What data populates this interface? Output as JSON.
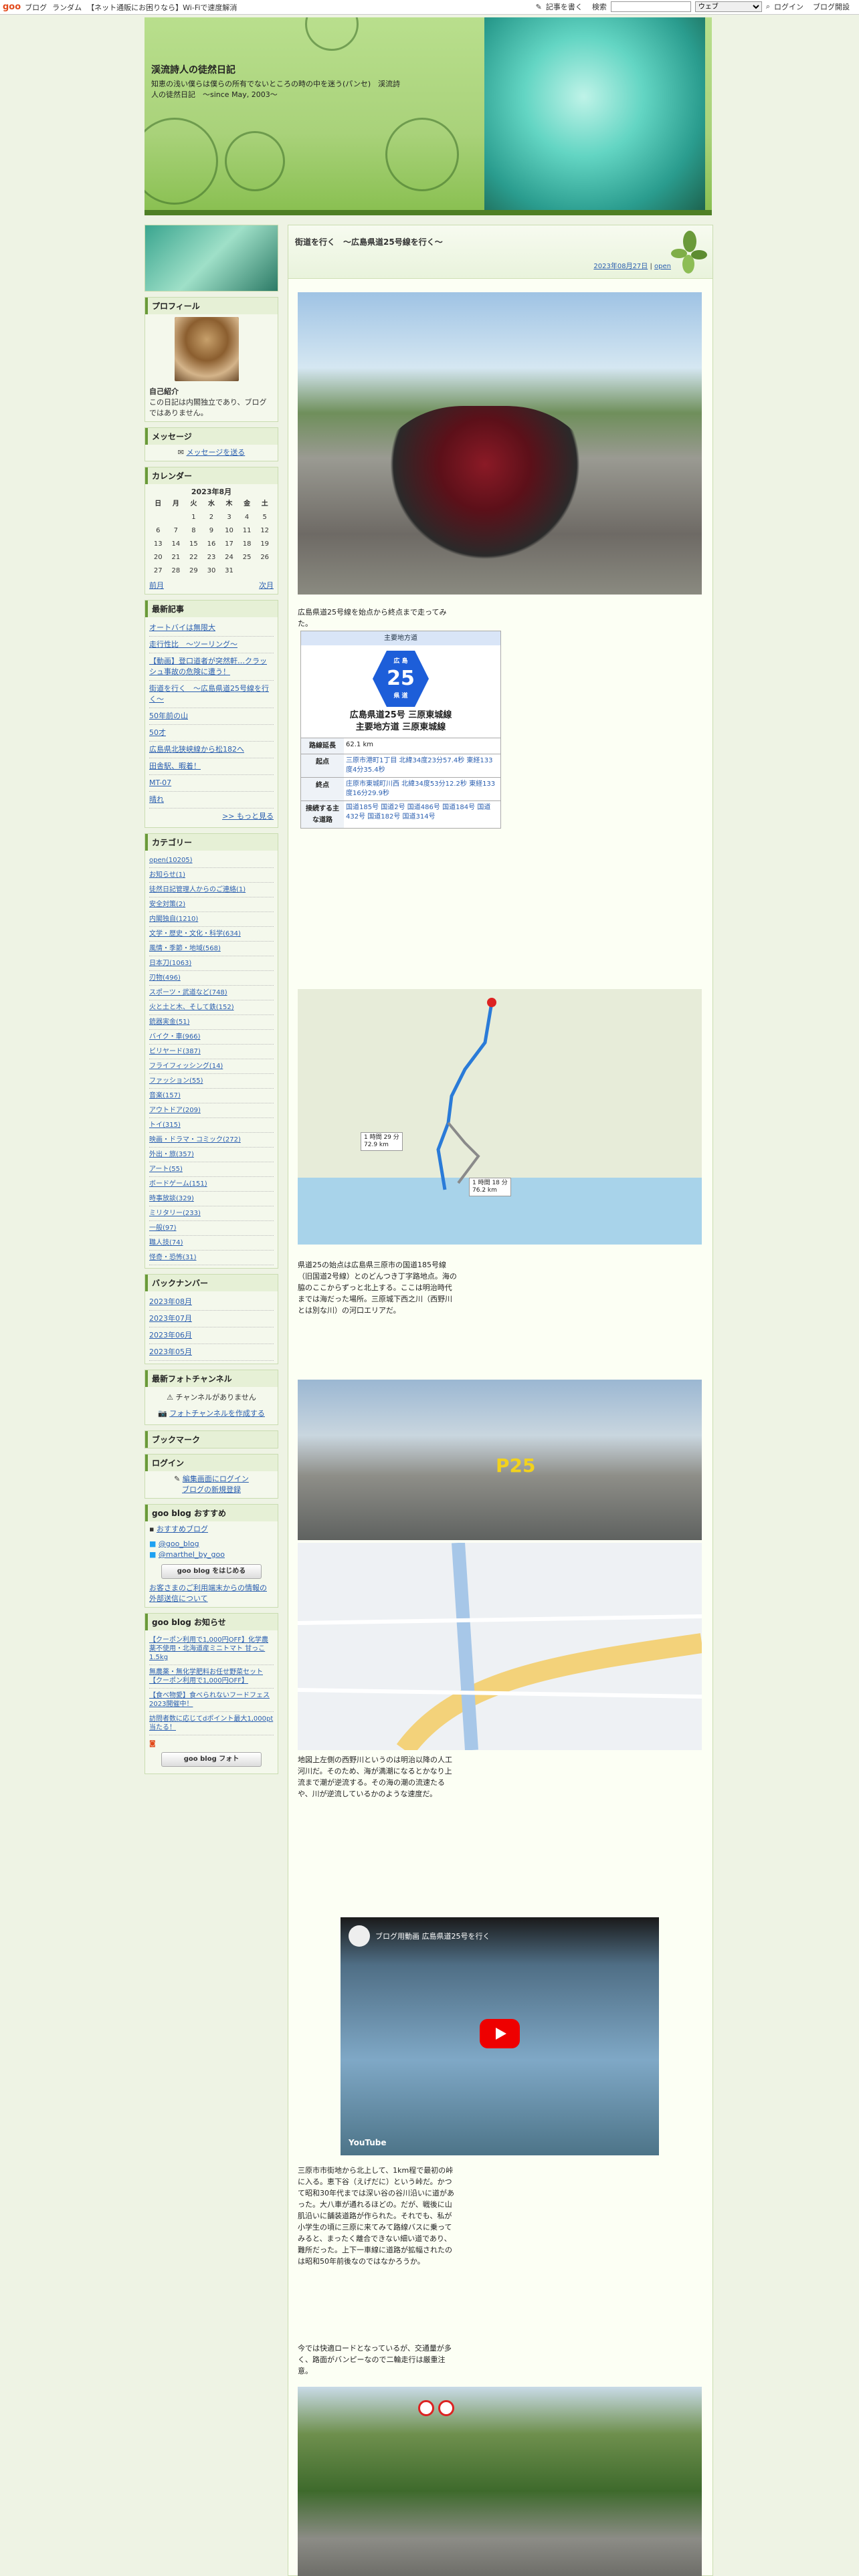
{
  "topbar": {
    "logo": "goo",
    "links": [
      "ブログ",
      "ランダム"
    ],
    "notice": "【ネット通販にお困りなら】Wi-Fiで速度解消",
    "search_label": "記事を書く",
    "search_button": "検索",
    "search_option": "ウェブ",
    "login": "ログイン",
    "blog_open": "ブログ開設"
  },
  "header": {
    "title": "渓流詩人の徒然日記",
    "description": "知恵の浅い僕らは僕らの所有でないところの時の中を迷う(パンセ)　渓流詩人の徒然日記　〜since May, 2003〜"
  },
  "sidebar": {
    "profile": {
      "heading": "プロフィール",
      "intro_label": "自己紹介",
      "intro": "この日記は内閣独立であり、ブログではありません。"
    },
    "message": {
      "heading": "メッセージ",
      "link": "メッセージを送る"
    },
    "calendar": {
      "heading": "カレンダー",
      "month": "2023年8月",
      "weekdays": [
        "日",
        "月",
        "火",
        "水",
        "木",
        "金",
        "土"
      ],
      "weeks": [
        [
          "",
          "",
          "1",
          "2",
          "3",
          "4",
          "5"
        ],
        [
          "6",
          "7",
          "8",
          "9",
          "10",
          "11",
          "12"
        ],
        [
          "13",
          "14",
          "15",
          "16",
          "17",
          "18",
          "19"
        ],
        [
          "20",
          "21",
          "22",
          "23",
          "24",
          "25",
          "26"
        ],
        [
          "27",
          "28",
          "29",
          "30",
          "31",
          "",
          ""
        ]
      ],
      "prev": "前月",
      "next": "次月"
    },
    "recent": {
      "heading": "最新記事",
      "items": [
        "オートバイは無限大",
        "走行性比　〜ツーリング〜",
        "【動画】登口道者が突然軒…クラッシュ事故の危険に遭う！",
        "街道を行く　〜広島県道25号線を行く〜",
        "50年前の山",
        "50才",
        "広島県北狭峡線から松182へ",
        "田舎駅、暇着！",
        "MT-07",
        "晴れ"
      ],
      "more": ">> もっと見る"
    },
    "category": {
      "heading": "カテゴリー",
      "items": [
        "open(10205)",
        "お知らせ(1)",
        "徒然日記管理人からのご連絡(1)",
        "安全対策(2)",
        "内閣独自(1210)",
        "文学・歴史・文化・科学(634)",
        "風情・季節・地域(568)",
        "日本刀(1063)",
        "刃物(496)",
        "スポーツ・武道など(748)",
        "火と土と木、そして鉄(152)",
        "銃器実金(51)",
        "バイク・車(966)",
        "ビリヤード(387)",
        "フライフィッシング(14)",
        "ファッション(55)",
        "音楽(157)",
        "アウトドア(209)",
        "トイ(315)",
        "映画・ドラマ・コミック(272)",
        "外出・旅(357)",
        "アート(55)",
        "ボードゲーム(151)",
        "時事放談(329)",
        "ミリタリー(233)",
        "一般(97)",
        "職人技(74)",
        "怪奇・恐怖(31)"
      ]
    },
    "backnumber": {
      "heading": "バックナンバー",
      "items": [
        "2023年08月",
        "2023年07月",
        "2023年06月",
        "2023年05月"
      ]
    },
    "photo_channel": {
      "heading": "最新フォトチャンネル",
      "empty": "チャンネルがありません",
      "create": "フォトチャンネルを作成する"
    },
    "bookmark": {
      "heading": "ブックマーク"
    },
    "login": {
      "heading": "ログイン",
      "edit": "編集画面にログイン",
      "register": "ブログの新規登録"
    },
    "goo_recommend": {
      "heading": "goo blog おすすめ",
      "item": "おすすめブログ",
      "twitter1": "@goo_blog",
      "twitter2": "@marthel_by_goo",
      "button": "goo blog をはじめる",
      "notice": "お客さまのご利用端末からの情報の外部送信について"
    },
    "goo_news": {
      "heading": "goo blog お知らせ",
      "items": [
        "【クーポン利用で1,000円OFF】化学農薬不使用・北海道産ミニトマト 甘っこ1.5kg",
        "無農薬・無化学肥料お任せ野菜セット【クーポン利用で1,000円OFF】",
        "【食べ物愛】食べられないフードフェス2023開催中！",
        "訪問者数に応じてdポイント最大1,000pt当たる！"
      ],
      "photo_button": "goo blog フォト"
    }
  },
  "entry": {
    "title": "街道を行く　〜広島県道25号線を行く〜",
    "date": "2023年08月27日",
    "category": "open",
    "intro": "広島県道25号線を始点から終点まで走ってみた。",
    "infobox": {
      "header": "主要地方道",
      "sign_top": "広 島",
      "number": "25",
      "sign_bottom": "県 道",
      "route_line1": "広島県道25号 三原東城線",
      "route_line2": "主要地方道 三原東城線",
      "rows": [
        {
          "label": "路線延長",
          "value": "62.1 km"
        },
        {
          "label": "起点",
          "value": "三原市港町1丁目 北緯34度23分57.4秒 東経133度4分35.4秒"
        },
        {
          "label": "終点",
          "value": "庄原市東城町川西 北緯34度53分12.2秒 東経133度16分29.9秒"
        },
        {
          "label": "接続する主な道路",
          "value": "国道185号 国道2号 国道486号 国道184号 国道432号 国道182号 国道314号"
        }
      ]
    },
    "map_labels": {
      "time1": "1 時間 29 分",
      "dist1": "72.9 km",
      "time2": "1 時間 18 分",
      "dist2": "76.2 km"
    },
    "para1": "県道25の始点は広島県三原市の国道185号線（旧国道2号線）とのどんつき丁字路地点。海の脇のここからずっと北上する。ここは明治時代までは海だった場所。三原城下西之川（西野川とは別な川）の河口エリアだ。",
    "sign_text": "P25",
    "para2": "地図上左側の西野川というのは明治以降の人工河川だ。そのため、海が満潮になるとかなり上流まで潮が逆流する。その海の潮の流速たるや、川が逆流しているかのような速度だ。",
    "video_title": "ブログ用動画 広島県道25号を行く",
    "youtube": "YouTube",
    "para3": "三原市市街地から北上して、1km程で最初の峠に入る。恵下谷（えげだに）という峠だ。かつて昭和30年代までは深い谷の谷川沿いに道があった。大八車が通れるほどの。だが、戦後に山肌沿いに舗装道路が作られた。それでも、私が小学生の頃に三原に来てみて路線バスに乗ってみると、まったく離合できない細い道であり、難所だった。上下一車線に道路が拡幅されたのは昭和50年前後なのではなかろうか。",
    "para4": "今では快適ロードとなっているが、交通量が多く、路面がバンピーなので二輪走行は厳重注意。"
  }
}
